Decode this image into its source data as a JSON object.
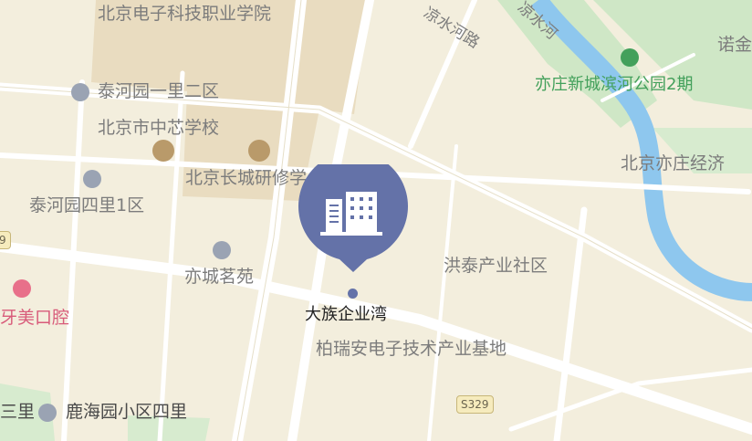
{
  "map": {
    "selected_place": "大族企业湾",
    "labels": {
      "edu1": "北京电子科技职业学院",
      "res1": "泰河园一里二区",
      "school1": "北京市中芯学校",
      "training": "北京长城研修学",
      "res2": "泰河园四里1区",
      "res3": "亦城茗苑",
      "dental": "牙美口腔",
      "edge_left": "三里",
      "res4": "鹿海园小区四里",
      "park": "亦庄新城滨河公园2期",
      "top_right": "诺金",
      "area1": "北京亦庄经济",
      "community": "洪泰产业社区",
      "industry": "柏瑞安电子技术产业基地",
      "road": "凉水河路",
      "river": "凉水河"
    },
    "road_shields": {
      "s329": "S329",
      "left": "9"
    },
    "icons": {
      "residential": "home-icon",
      "school": "school-icon",
      "education": "graduation-cap-icon",
      "park": "tree-icon",
      "dental": "tooth-icon",
      "marker": "office-building-icon"
    },
    "colors": {
      "land": "#f3eedd",
      "campus": "#e9dcc0",
      "park": "#cfe7c6",
      "river": "#8ec7ee",
      "road": "#ffffff",
      "marker": "#6472a8"
    }
  }
}
